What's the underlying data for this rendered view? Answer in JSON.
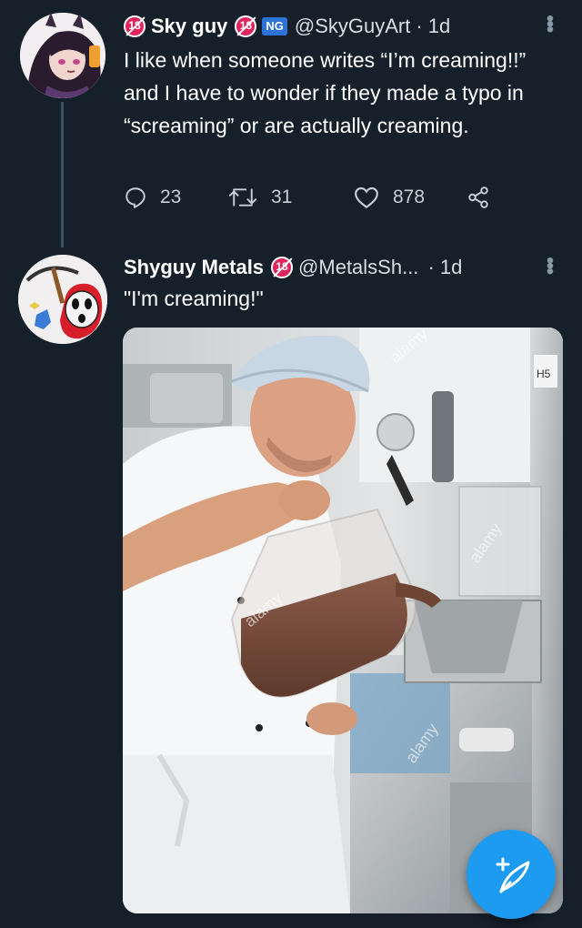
{
  "tweet1": {
    "badge": "18",
    "name": "Sky guy",
    "badge2": "18",
    "ng_badge": "NG",
    "handle": "@SkyGuyArt",
    "time": "· 1d",
    "text": "I like when someone writes “I’m creaming!!” and I have to wonder if they made a typo in “screaming” or are actually creaming.",
    "replies": "23",
    "retweets": "31",
    "likes": "878"
  },
  "tweet2": {
    "name": "Shyguy Metals",
    "badge": "18",
    "handle": "@MetalsSh...",
    "time": "· 1d",
    "text": "\"I'm creaming!\""
  },
  "media": {
    "watermark": "alamy",
    "label_h5": "H5"
  },
  "icons": [
    "reply-icon",
    "retweet-icon",
    "like-icon",
    "share-icon",
    "more-icon",
    "compose-icon"
  ],
  "colors": {
    "background": "#15202b",
    "accent": "#1d9bf0",
    "badge": "#e0245e",
    "ng": "#2b73d6"
  }
}
